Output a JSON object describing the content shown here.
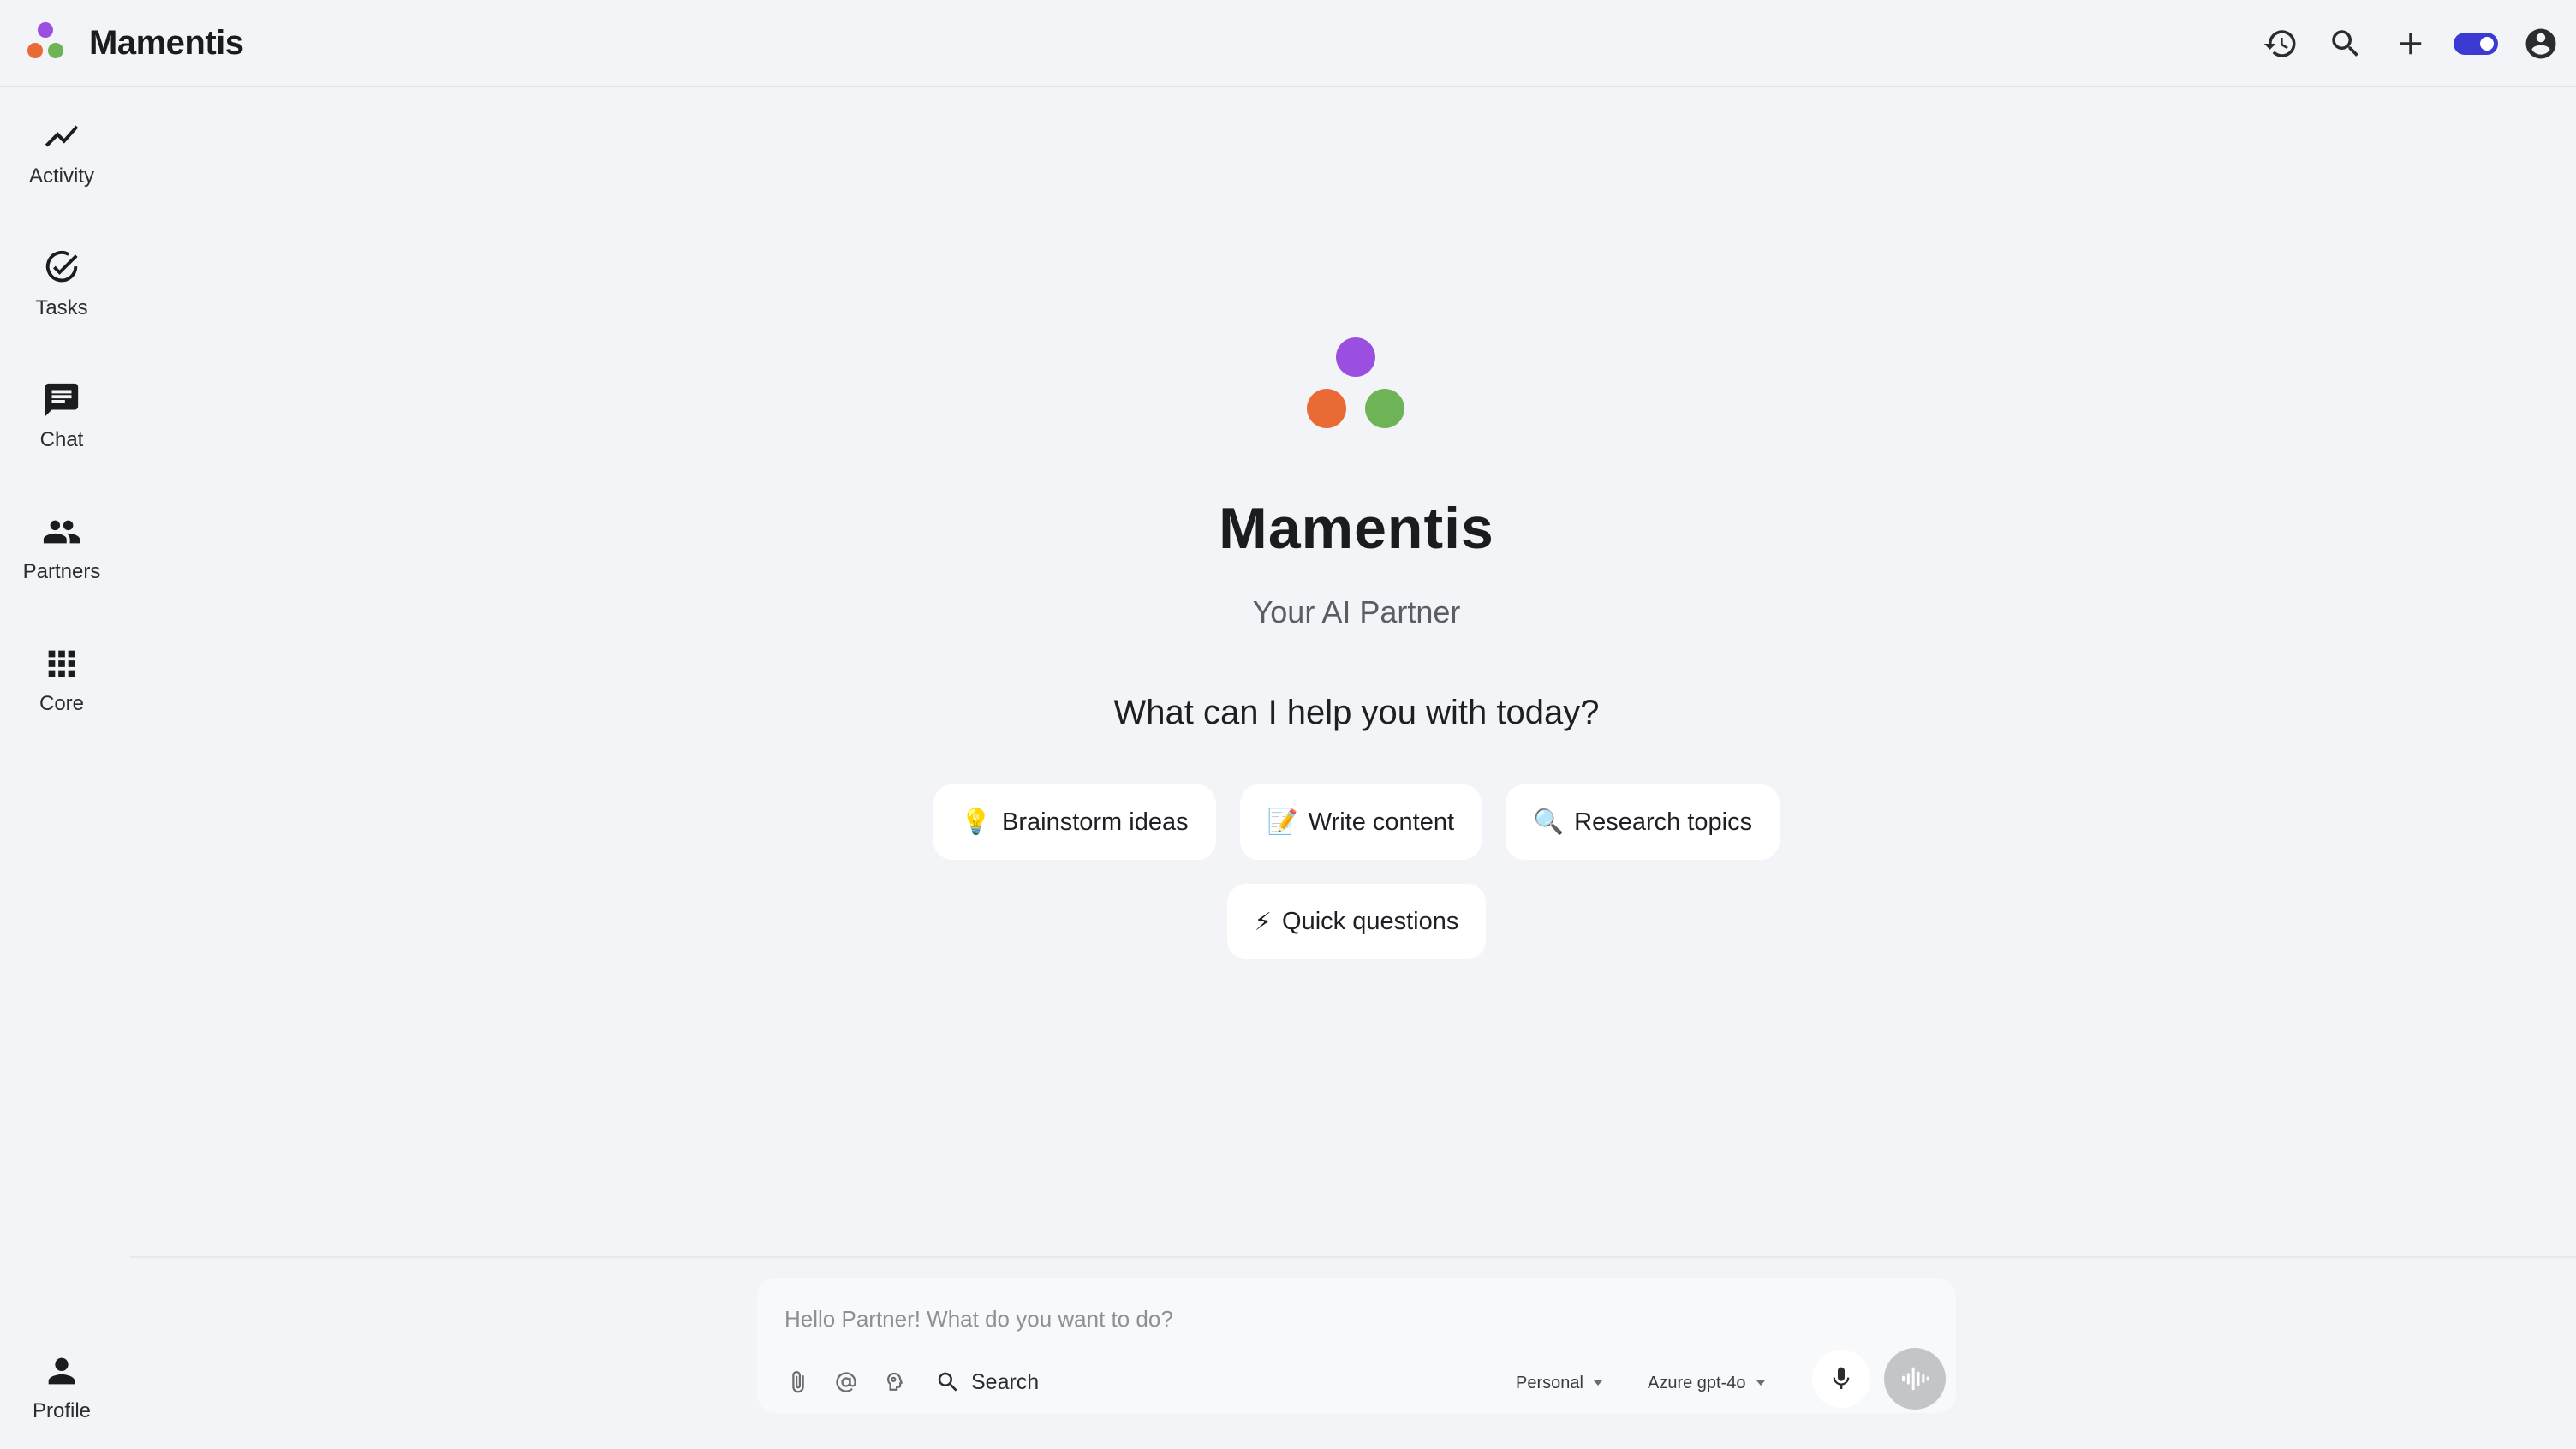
{
  "app": {
    "name": "Mamentis",
    "brand_colors": {
      "purple": "#9a4fe0",
      "orange": "#ea6a35",
      "green": "#6eb356"
    }
  },
  "header": {
    "actions": [
      {
        "id": "history",
        "icon": "history-icon"
      },
      {
        "id": "search",
        "icon": "search-icon"
      },
      {
        "id": "new",
        "icon": "plus-icon"
      },
      {
        "id": "toggle",
        "icon": "toggle-switch",
        "state": "on",
        "color": "#3b3bd4"
      },
      {
        "id": "account",
        "icon": "account-circle-icon"
      }
    ]
  },
  "sidebar": {
    "items": [
      {
        "label": "Activity",
        "icon": "activity-chart-icon"
      },
      {
        "label": "Tasks",
        "icon": "check-circle-icon"
      },
      {
        "label": "Chat",
        "icon": "chat-bubble-icon"
      },
      {
        "label": "Partners",
        "icon": "people-icon"
      },
      {
        "label": "Core",
        "icon": "grid-icon"
      }
    ],
    "profile": {
      "label": "Profile",
      "icon": "person-icon"
    }
  },
  "hero": {
    "title": "Mamentis",
    "subtitle": "Your AI Partner",
    "question": "What can I help you with today?"
  },
  "suggestions": [
    {
      "emoji": "💡",
      "label": "Brainstorm ideas"
    },
    {
      "emoji": "📝",
      "label": "Write content"
    },
    {
      "emoji": "🔍",
      "label": "Research topics"
    },
    {
      "emoji": "⚡",
      "label": "Quick questions"
    }
  ],
  "composer": {
    "placeholder": "Hello Partner! What do you want to do?",
    "value": "",
    "tools": [
      {
        "icon": "paperclip-icon"
      },
      {
        "icon": "at-sign-icon"
      },
      {
        "icon": "brain-icon"
      }
    ],
    "search_label": "Search",
    "mode": {
      "selected": "Personal"
    },
    "model": {
      "selected": "Azure gpt-4o"
    }
  }
}
